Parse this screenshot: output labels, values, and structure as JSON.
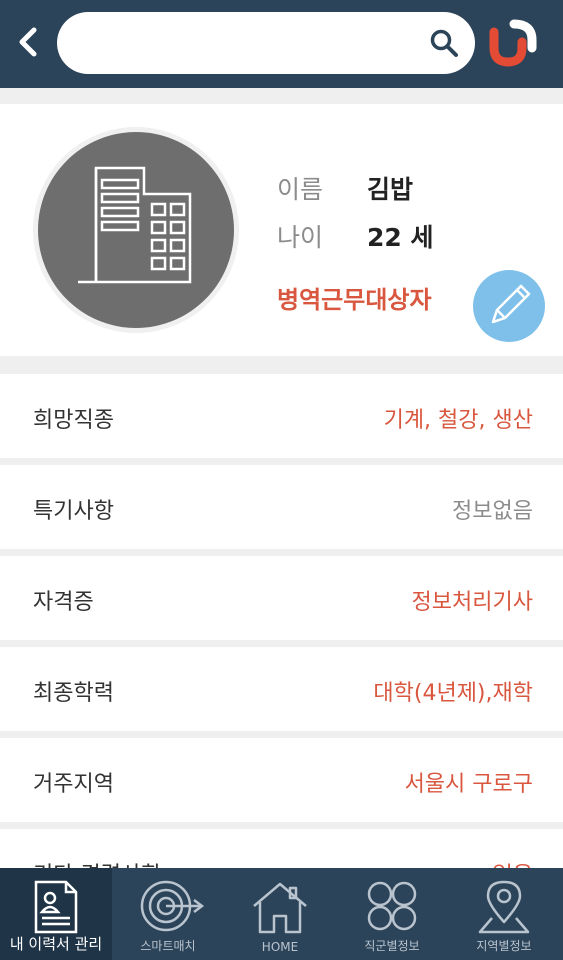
{
  "header": {
    "search_placeholder": "",
    "icons": [
      "back-icon",
      "search-icon",
      "brand-logo"
    ]
  },
  "profile": {
    "name_label": "이름",
    "name_value": "김밥",
    "age_label": "나이",
    "age_value": "22 세",
    "status": "병역근무대상자"
  },
  "rows": [
    {
      "label": "희망직종",
      "value": "기계, 철강, 생산"
    },
    {
      "label": "특기사항",
      "value": "정보없음"
    },
    {
      "label": "자격증",
      "value": "정보처리기사"
    },
    {
      "label": "최종학력",
      "value": "대학(4년제),재학"
    },
    {
      "label": "거주지역",
      "value": "서울시 구로구"
    },
    {
      "label": "기타 경력사항",
      "value": "없음"
    }
  ],
  "nav": [
    {
      "label": "내 이력서 관리",
      "icon": "resume-icon",
      "active": true
    },
    {
      "label": "스마트매치",
      "icon": "target-icon",
      "active": false
    },
    {
      "label": "HOME",
      "icon": "home-icon",
      "active": false
    },
    {
      "label": "직군별정보",
      "icon": "grid-circles-icon",
      "active": false
    },
    {
      "label": "지역별정보",
      "icon": "location-pin-icon",
      "active": false
    }
  ],
  "colors": {
    "header_bg": "#2c4459",
    "accent_red": "#d9573f",
    "edit_button": "#7fc0ea",
    "page_bg": "#efefef"
  }
}
